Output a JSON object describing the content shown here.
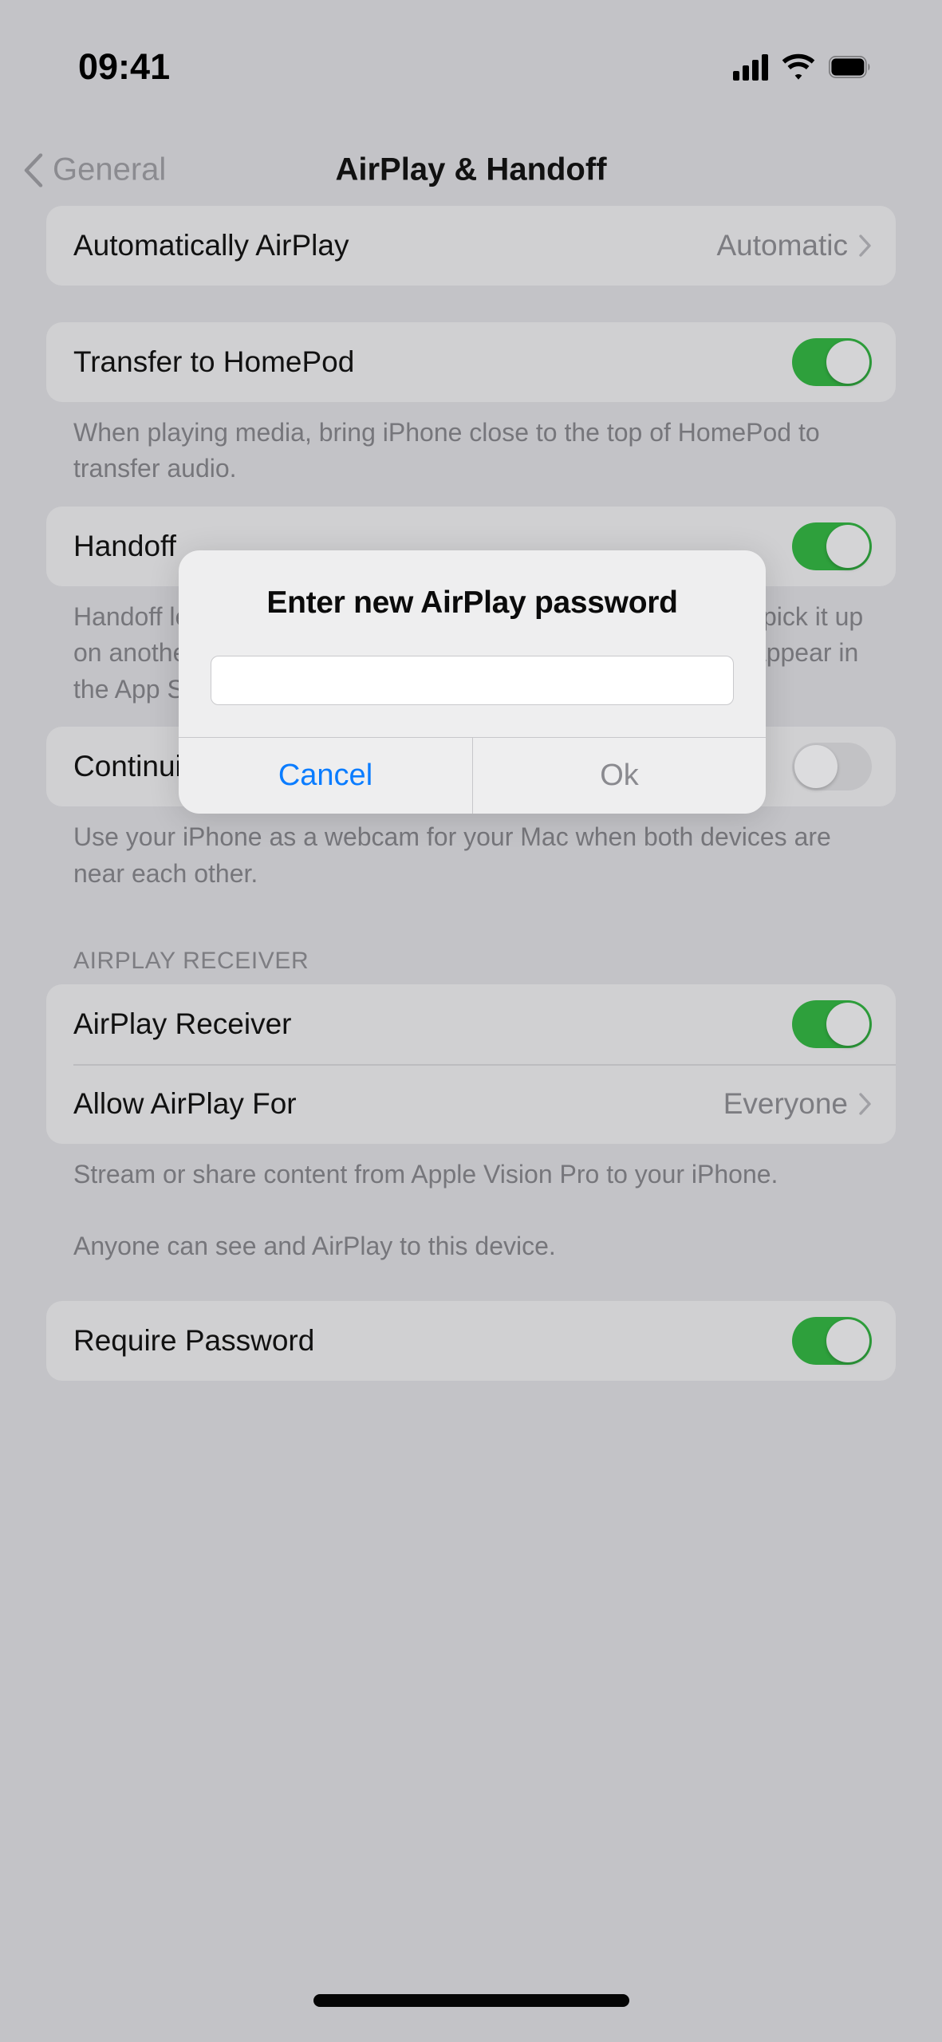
{
  "status_bar": {
    "time": "09:41",
    "cellular_icon": "cellular-signal-icon",
    "wifi_icon": "wifi-icon",
    "battery_icon": "battery-full-icon"
  },
  "nav": {
    "back_label": "General",
    "back_icon": "chevron-left-icon",
    "title": "AirPlay & Handoff"
  },
  "sections": {
    "automatically_airplay": {
      "label": "Automatically AirPlay",
      "value": "Automatic",
      "chevron_icon": "chevron-right-icon"
    },
    "transfer_to_homepod": {
      "label": "Transfer to HomePod",
      "toggle_state": "on",
      "footer": "When playing media, bring iPhone close to the top of HomePod to transfer audio."
    },
    "handoff": {
      "label": "Handoff",
      "toggle_state": "on",
      "footer": "Handoff lets you start something on one device and instantly pick it up on another device that is nearby. The app you are using will appear in the App Switcher, the Dock on iPad, and the Dock on a Mac."
    },
    "continuity_camera": {
      "label": "Continuity Camera",
      "toggle_state": "off",
      "footer": "Use your iPhone as a webcam for your Mac when both devices are near each other."
    },
    "airplay_receiver": {
      "header": "AIRPLAY RECEIVER",
      "receiver_label": "AirPlay Receiver",
      "receiver_toggle_state": "on",
      "allow_label": "Allow AirPlay For",
      "allow_value": "Everyone",
      "chevron_icon": "chevron-right-icon",
      "footer_line1": "Stream or share content from Apple Vision Pro to your iPhone.",
      "footer_line2": "Anyone can see and AirPlay to this device."
    },
    "require_password": {
      "label": "Require Password",
      "toggle_state": "on"
    }
  },
  "alert": {
    "title": "Enter new AirPlay password",
    "input_value": "",
    "input_placeholder": "",
    "cancel_label": "Cancel",
    "ok_label": "Ok"
  },
  "colors": {
    "toggle_on": "#2ea03c",
    "toggle_off": "#c2c2c5",
    "tint_blue": "#0a7cff",
    "page_background": "#c3c3c7",
    "group_background": "#d0d0d2"
  }
}
